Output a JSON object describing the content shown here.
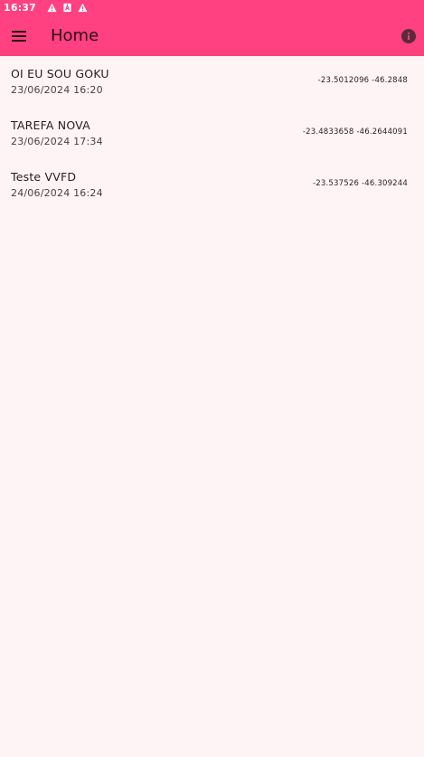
{
  "status_bar": {
    "time": "16:37",
    "icons": [
      "warning-icon",
      "a-badge-icon",
      "warning-icon"
    ]
  },
  "app_bar": {
    "title": "Home",
    "menu_icon": "menu-icon",
    "info_icon": "info-icon",
    "color": "#ff4081"
  },
  "tasks": [
    {
      "title": "OI EU SOU GOKU",
      "date": "23/06/2024 16:20",
      "coords": "-23.5012096 -46.2848"
    },
    {
      "title": "TAREFA NOVA",
      "date": "23/06/2024 17:34",
      "coords": "-23.4833658 -46.2644091"
    },
    {
      "title": "Teste VVFD",
      "date": "24/06/2024 16:24",
      "coords": "-23.537526 -46.309244"
    }
  ]
}
